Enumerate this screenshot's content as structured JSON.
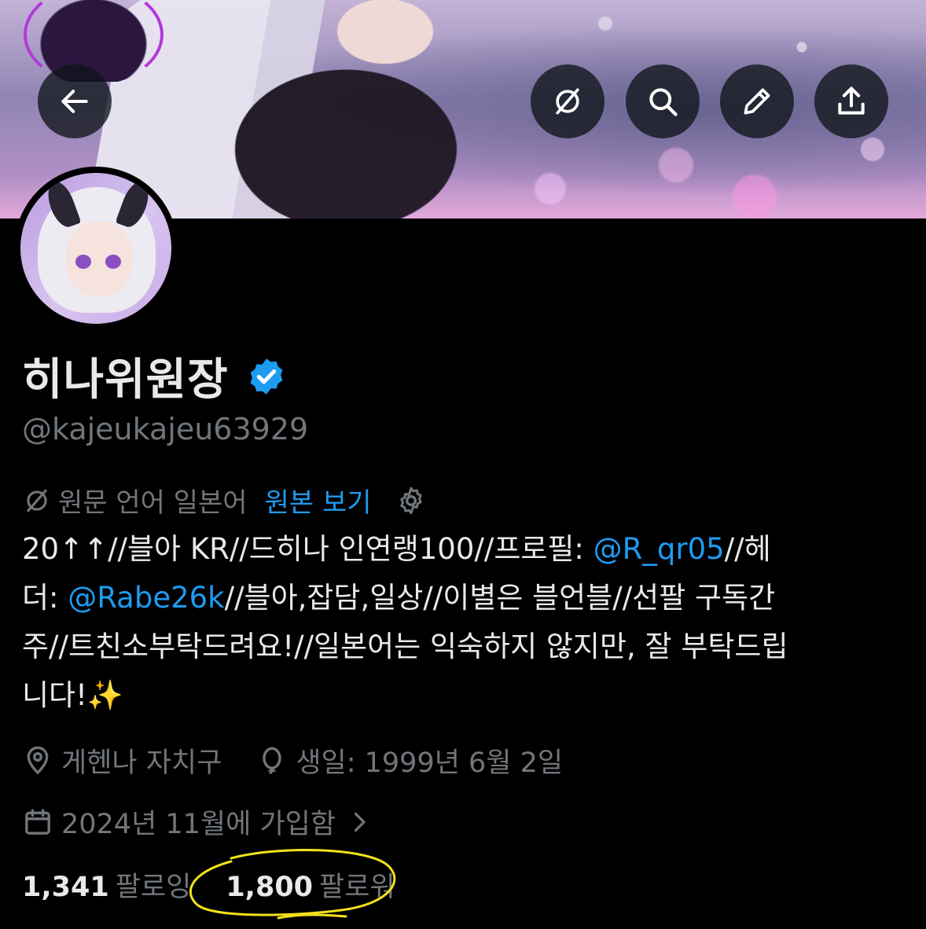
{
  "header": {
    "icons": [
      "back-arrow-icon",
      "translate-icon",
      "search-icon",
      "edit-pencil-icon",
      "share-icon"
    ]
  },
  "profile": {
    "display_name": "히나위원장",
    "handle": "@kajeukajeu63929",
    "verified": true
  },
  "translation": {
    "source_language_text": "원문 언어 일본어",
    "view_original_label": "원본 보기"
  },
  "bio": {
    "line1_a": "20↑↑//블아 KR//드히나 인연랭100//프로필: ",
    "mention1": "@R_qr05",
    "line1_b": "//헤",
    "line2_a": "더: ",
    "mention2": "@Rabe26k",
    "line2_b": "//블아,잡담,일상//이별은 블언블//선팔 구독간",
    "line3": "주//트친소부탁드려요!//일본어는 익숙하지 않지만, 잘 부탁드립",
    "line4": "니다!",
    "sparkles": "✨"
  },
  "meta": {
    "location": "게헨나 자치구",
    "birthday": "생일: 1999년 6월 2일",
    "joined": "2024년 11월에 가입함"
  },
  "stats": {
    "following_count": "1,341",
    "following_label": "팔로잉",
    "followers_count": "1,800",
    "followers_label": "팔로워"
  },
  "colors": {
    "accent": "#1d9bf0",
    "secondary_text": "#71767b",
    "highlight_circle": "#f2e21b"
  }
}
